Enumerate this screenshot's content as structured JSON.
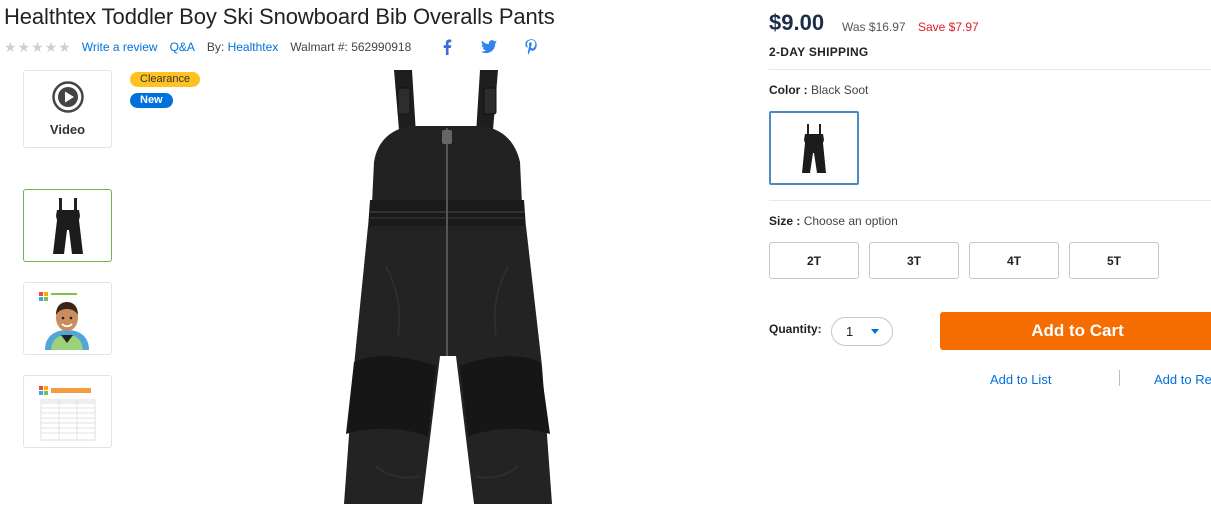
{
  "product": {
    "title": "Healthtex Toddler Boy Ski Snowboard Bib Overalls Pants",
    "rating_stars": "★★★★★",
    "write_review": "Write a review",
    "qa": "Q&A",
    "by_label": "By:",
    "brand": "Healthtex",
    "walmart_label": "Walmart #:",
    "walmart_number": "562990918"
  },
  "social": {
    "icons": [
      "facebook-icon",
      "twitter-icon",
      "pinterest-icon"
    ]
  },
  "gallery": {
    "video_label": "Video",
    "badges": {
      "clearance": "Clearance",
      "new": "New"
    },
    "thumbnails": [
      "video",
      "product-front",
      "model-photo",
      "size-chart"
    ]
  },
  "pricing": {
    "price": "$9.00",
    "was": "Was $16.97",
    "save": "Save $7.97",
    "shipping": "2-DAY SHIPPING"
  },
  "options": {
    "color_label": "Color :",
    "color_value": "Black Soot",
    "size_label": "Size :",
    "size_prompt": "Choose an option",
    "sizes": [
      "2T",
      "3T",
      "4T",
      "5T"
    ]
  },
  "purchase": {
    "quantity_label": "Quantity:",
    "quantity_value": "1",
    "add_to_cart": "Add to Cart",
    "add_to_list": "Add to List",
    "add_to_registry": "Add to Re"
  },
  "colors": {
    "accent_blue": "#0071dc",
    "cart_orange": "#f56c00",
    "save_red": "#de1c24",
    "clearance_yellow": "#ffc220",
    "price_navy": "#1c2d4a"
  }
}
